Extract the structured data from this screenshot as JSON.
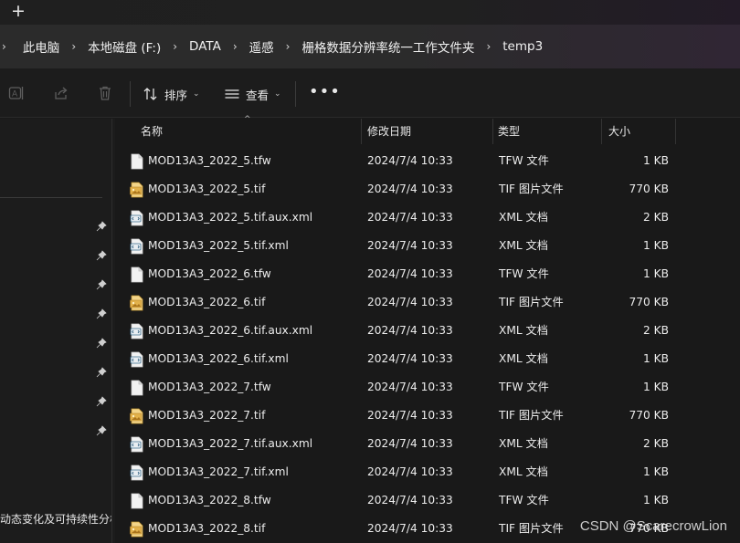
{
  "titlebar": {
    "new_tab_icon": "plus-icon"
  },
  "breadcrumb": {
    "items": [
      "此电脑",
      "本地磁盘 (F:)",
      "DATA",
      "遥感",
      "栅格数据分辨率统一工作文件夹",
      "temp3"
    ]
  },
  "commandbar": {
    "sort_label": "排序",
    "view_label": "查看",
    "more_label": "•••"
  },
  "nav": {
    "truncated_item": "动态变化及可持续性分析"
  },
  "columns": {
    "name": "名称",
    "modified": "修改日期",
    "type": "类型",
    "size": "大小"
  },
  "files": [
    {
      "name": "MOD13A3_2022_5.tfw",
      "modified": "2024/7/4 10:33",
      "type": "TFW 文件",
      "size": "1 KB",
      "icon": "file-icon"
    },
    {
      "name": "MOD13A3_2022_5.tif",
      "modified": "2024/7/4 10:33",
      "type": "TIF 图片文件",
      "size": "770 KB",
      "icon": "image-file-icon"
    },
    {
      "name": "MOD13A3_2022_5.tif.aux.xml",
      "modified": "2024/7/4 10:33",
      "type": "XML 文档",
      "size": "2 KB",
      "icon": "xml-file-icon"
    },
    {
      "name": "MOD13A3_2022_5.tif.xml",
      "modified": "2024/7/4 10:33",
      "type": "XML 文档",
      "size": "1 KB",
      "icon": "xml-file-icon"
    },
    {
      "name": "MOD13A3_2022_6.tfw",
      "modified": "2024/7/4 10:33",
      "type": "TFW 文件",
      "size": "1 KB",
      "icon": "file-icon"
    },
    {
      "name": "MOD13A3_2022_6.tif",
      "modified": "2024/7/4 10:33",
      "type": "TIF 图片文件",
      "size": "770 KB",
      "icon": "image-file-icon"
    },
    {
      "name": "MOD13A3_2022_6.tif.aux.xml",
      "modified": "2024/7/4 10:33",
      "type": "XML 文档",
      "size": "2 KB",
      "icon": "xml-file-icon"
    },
    {
      "name": "MOD13A3_2022_6.tif.xml",
      "modified": "2024/7/4 10:33",
      "type": "XML 文档",
      "size": "1 KB",
      "icon": "xml-file-icon"
    },
    {
      "name": "MOD13A3_2022_7.tfw",
      "modified": "2024/7/4 10:33",
      "type": "TFW 文件",
      "size": "1 KB",
      "icon": "file-icon"
    },
    {
      "name": "MOD13A3_2022_7.tif",
      "modified": "2024/7/4 10:33",
      "type": "TIF 图片文件",
      "size": "770 KB",
      "icon": "image-file-icon"
    },
    {
      "name": "MOD13A3_2022_7.tif.aux.xml",
      "modified": "2024/7/4 10:33",
      "type": "XML 文档",
      "size": "2 KB",
      "icon": "xml-file-icon"
    },
    {
      "name": "MOD13A3_2022_7.tif.xml",
      "modified": "2024/7/4 10:33",
      "type": "XML 文档",
      "size": "1 KB",
      "icon": "xml-file-icon"
    },
    {
      "name": "MOD13A3_2022_8.tfw",
      "modified": "2024/7/4 10:33",
      "type": "TFW 文件",
      "size": "1 KB",
      "icon": "file-icon"
    },
    {
      "name": "MOD13A3_2022_8.tif",
      "modified": "2024/7/4 10:33",
      "type": "TIF 图片文件",
      "size": "770 KB",
      "icon": "image-file-icon"
    }
  ],
  "watermark": "CSDN @ScarecrowLion",
  "colors": {
    "background": "#191919",
    "address_bar": "#2b2b2b",
    "text": "#e6e6e6",
    "tif_icon": "#e2b14a"
  }
}
